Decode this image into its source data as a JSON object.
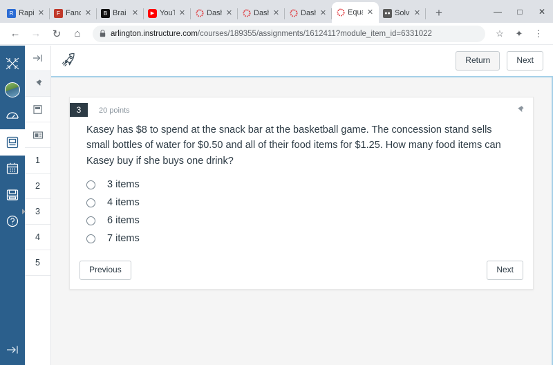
{
  "browser": {
    "tabs": [
      {
        "title": "Rapi",
        "favicon": "rapid-icon",
        "active": false
      },
      {
        "title": "Fanc",
        "favicon": "fancy-icon",
        "active": false
      },
      {
        "title": "Brai",
        "favicon": "brainly-icon",
        "active": false
      },
      {
        "title": "YouT",
        "favicon": "youtube-icon",
        "active": false
      },
      {
        "title": "Dash",
        "favicon": "canvas-icon",
        "active": false
      },
      {
        "title": "Dash",
        "favicon": "canvas-icon",
        "active": false
      },
      {
        "title": "Dash",
        "favicon": "canvas-icon",
        "active": false
      },
      {
        "title": "Equa",
        "favicon": "canvas-icon",
        "active": true
      },
      {
        "title": "Solv",
        "favicon": "solver-icon",
        "active": false
      }
    ],
    "new_tab_label": "+",
    "close_label": "✕",
    "window_controls": {
      "minimize": "—",
      "maximize": "□",
      "close": "✕"
    },
    "nav": {
      "back": "←",
      "forward": "→",
      "reload": "↻",
      "home": "⌂"
    },
    "omnibox": {
      "host": "arlington.instructure.com",
      "path": "/courses/189355/assignments/1612411?module_item_id=6331022",
      "lock": "lock-icon"
    },
    "toolbar_icons": {
      "bookmark": "☆",
      "extensions": "✦",
      "menu": "⋮"
    }
  },
  "global_nav": {
    "items": [
      {
        "name": "canvas-logo",
        "glyph": "✈"
      },
      {
        "name": "account-avatar",
        "glyph": ""
      },
      {
        "name": "dashboard",
        "glyph": "◔"
      },
      {
        "name": "courses",
        "glyph": "▤",
        "active": true
      },
      {
        "name": "calendar",
        "glyph": "▦"
      },
      {
        "name": "inbox",
        "glyph": "✉"
      },
      {
        "name": "help",
        "glyph": "?"
      }
    ],
    "expand_label": "→|"
  },
  "question_rail": {
    "tools": [
      {
        "name": "collapse",
        "glyph": "→|"
      },
      {
        "name": "pin",
        "glyph": "⚑"
      },
      {
        "name": "page-view",
        "glyph": "□"
      },
      {
        "name": "list-view",
        "glyph": "▤"
      }
    ],
    "numbers": [
      "1",
      "2",
      "3",
      "4",
      "5"
    ],
    "current": "3"
  },
  "app_bar": {
    "logo": "rocket-icon",
    "return_label": "Return",
    "next_label": "Next"
  },
  "question": {
    "number": "3",
    "points": "20 points",
    "pin_icon": "pushpin-icon",
    "text": "Kasey has $8 to spend at the snack bar at the basketball game. The concession stand sells small bottles of water for $0.50 and all of their food items for $1.25. How many food items can Kasey buy if she buys one drink?",
    "answers": [
      {
        "label": "3 items",
        "selected": false
      },
      {
        "label": "4 items",
        "selected": false
      },
      {
        "label": "6 items",
        "selected": false
      },
      {
        "label": "7 items",
        "selected": false
      }
    ],
    "previous_label": "Previous",
    "next_label": "Next"
  },
  "colors": {
    "canvas_blue": "#2b5f8c",
    "tabstrip": "#dee1e6",
    "quiz_bg": "#f5f5f5",
    "accent_border": "#a5d0e8",
    "badge_dark": "#2d3b45",
    "canvas_red": "#e03a3e"
  }
}
